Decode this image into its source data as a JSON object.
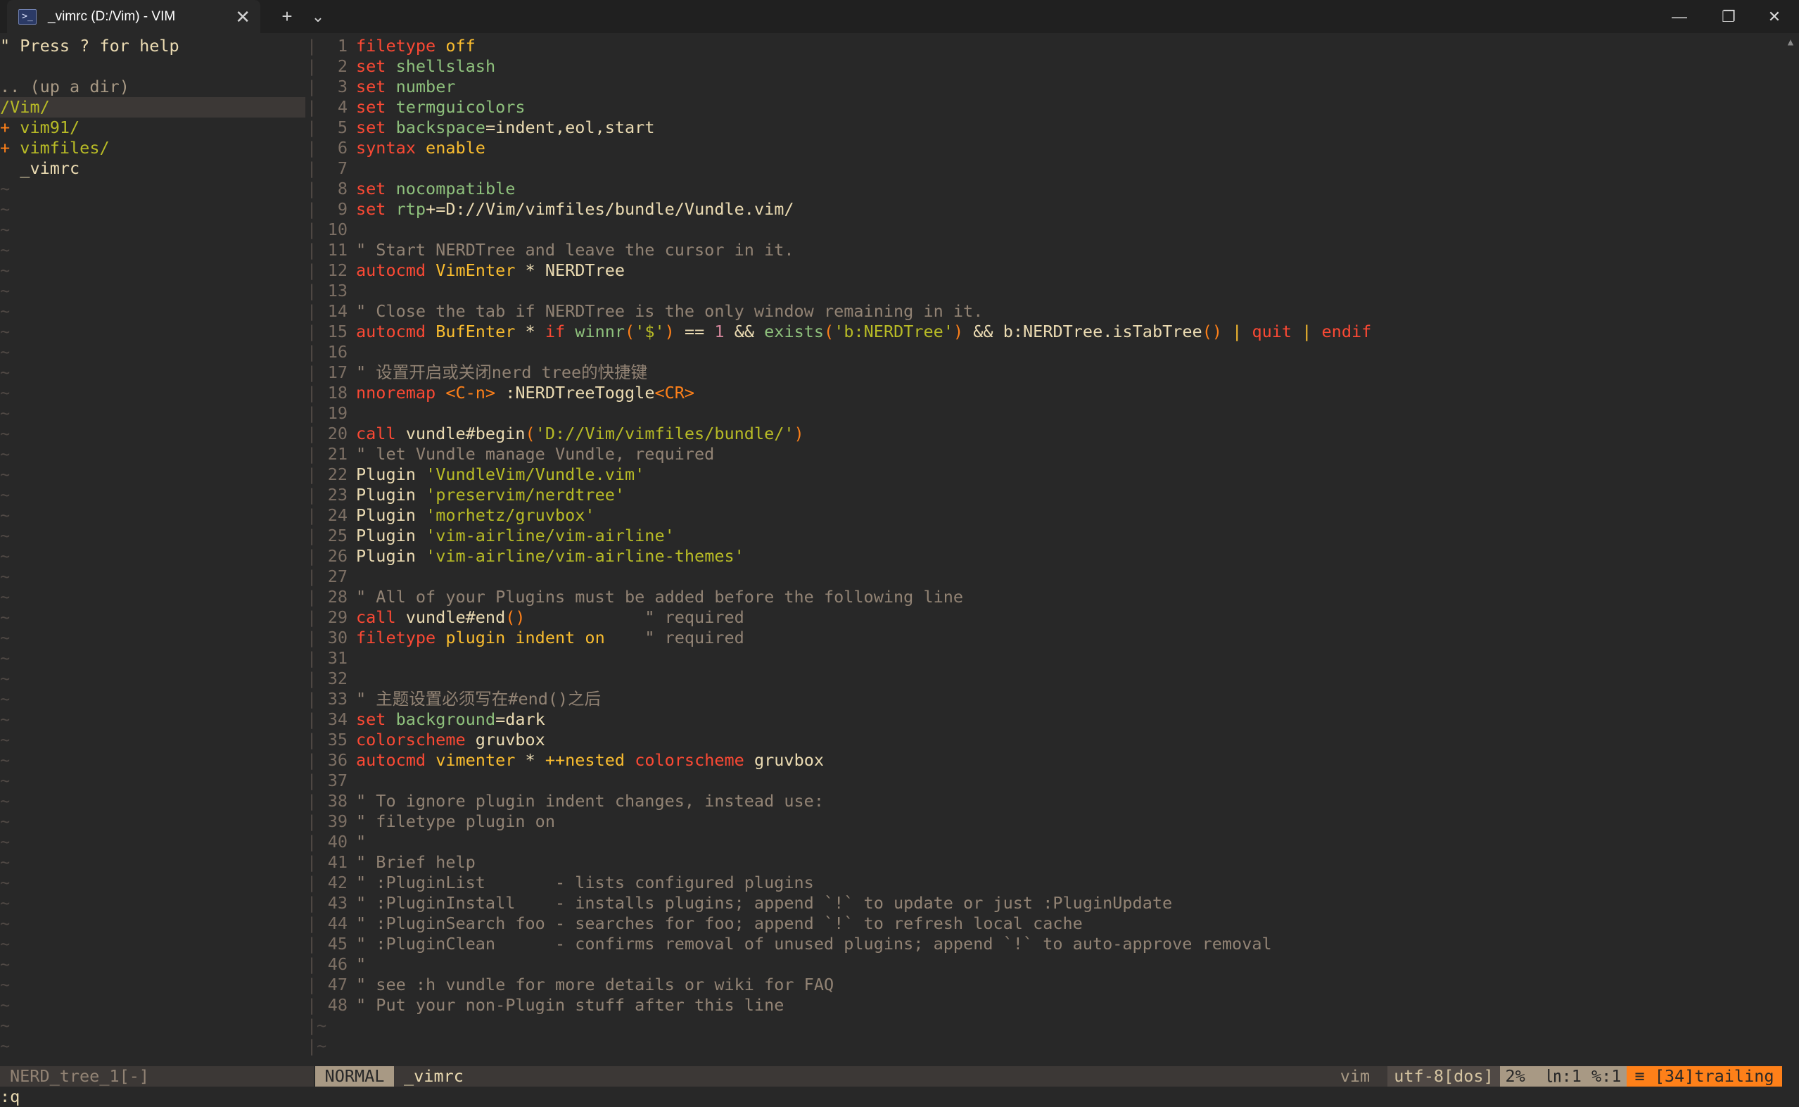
{
  "window": {
    "tab_title": "_vimrc (D:/Vim) - VIM",
    "tab_icon": "terminal-icon",
    "close_tab_glyph": "✕",
    "new_tab_glyph": "+",
    "dropdown_glyph": "⌄",
    "minimize_glyph": "—",
    "restore_glyph": "❐",
    "close_glyph": "✕"
  },
  "tree": {
    "help": "\" Press ? for help",
    "updir": ".. (up a dir)",
    "cwd": "/Vim/",
    "items": [
      {
        "prefix": "+ ",
        "name": "vim91/",
        "type": "dir"
      },
      {
        "prefix": "+ ",
        "name": "vimfiles/",
        "type": "dir"
      },
      {
        "prefix": "  ",
        "name": "_vimrc",
        "type": "file"
      }
    ],
    "filler": "~"
  },
  "code": [
    {
      "n": "1",
      "t": [
        [
          "kw",
          "filetype"
        ],
        [
          "pl",
          " "
        ],
        [
          "kv",
          "off"
        ]
      ]
    },
    {
      "n": "2",
      "t": [
        [
          "kw",
          "set"
        ],
        [
          "pl",
          " "
        ],
        [
          "opt",
          "shellslash"
        ]
      ]
    },
    {
      "n": "3",
      "t": [
        [
          "kw",
          "set"
        ],
        [
          "pl",
          " "
        ],
        [
          "opt",
          "number"
        ]
      ]
    },
    {
      "n": "4",
      "t": [
        [
          "kw",
          "set"
        ],
        [
          "pl",
          " "
        ],
        [
          "opt",
          "termguicolors"
        ]
      ]
    },
    {
      "n": "5",
      "t": [
        [
          "kw",
          "set"
        ],
        [
          "pl",
          " "
        ],
        [
          "opt",
          "backspace"
        ],
        [
          "pl",
          "=indent,eol,start"
        ]
      ]
    },
    {
      "n": "6",
      "t": [
        [
          "kw",
          "syntax"
        ],
        [
          "pl",
          " "
        ],
        [
          "kv",
          "enable"
        ]
      ]
    },
    {
      "n": "7",
      "t": []
    },
    {
      "n": "8",
      "t": [
        [
          "kw",
          "set"
        ],
        [
          "pl",
          " "
        ],
        [
          "opt",
          "nocompatible"
        ]
      ]
    },
    {
      "n": "9",
      "t": [
        [
          "kw",
          "set"
        ],
        [
          "pl",
          " "
        ],
        [
          "opt",
          "rtp"
        ],
        [
          "pl",
          "+=D://Vim/vimfiles/bundle/Vundle.vim/"
        ]
      ]
    },
    {
      "n": "10",
      "t": []
    },
    {
      "n": "11",
      "t": [
        [
          "cm",
          "\" Start NERDTree and leave the cursor in it."
        ]
      ]
    },
    {
      "n": "12",
      "t": [
        [
          "kw",
          "autocmd"
        ],
        [
          "pl",
          " "
        ],
        [
          "ev",
          "VimEnter"
        ],
        [
          "pl",
          " * NERDTree"
        ]
      ]
    },
    {
      "n": "13",
      "t": []
    },
    {
      "n": "14",
      "t": [
        [
          "cm",
          "\" Close the tab if NERDTree is the only window remaining in it."
        ]
      ]
    },
    {
      "n": "15",
      "t": [
        [
          "kw",
          "autocmd"
        ],
        [
          "pl",
          " "
        ],
        [
          "ev",
          "BufEnter"
        ],
        [
          "pl",
          " * "
        ],
        [
          "kw",
          "if"
        ],
        [
          "pl",
          " "
        ],
        [
          "fn",
          "winnr"
        ],
        [
          "sp",
          "("
        ],
        [
          "str",
          "'$'"
        ],
        [
          "sp",
          ")"
        ],
        [
          "pl",
          " == "
        ],
        [
          "num",
          "1"
        ],
        [
          "pl",
          " && "
        ],
        [
          "fn",
          "exists"
        ],
        [
          "sp",
          "("
        ],
        [
          "str",
          "'b:NERDTree'"
        ],
        [
          "sp",
          ")"
        ],
        [
          "pl",
          " && b:NERDTree.isTabTree"
        ],
        [
          "sp",
          "()"
        ],
        [
          "pl",
          " "
        ],
        [
          "kv",
          "|"
        ],
        [
          "pl",
          " "
        ],
        [
          "kw",
          "quit"
        ],
        [
          "pl",
          " "
        ],
        [
          "kv",
          "|"
        ],
        [
          "pl",
          " "
        ],
        [
          "kw",
          "endif"
        ]
      ]
    },
    {
      "n": "16",
      "t": []
    },
    {
      "n": "17",
      "t": [
        [
          "cm",
          "\" 设置开启或关闭nerd tree的快捷键"
        ]
      ]
    },
    {
      "n": "18",
      "t": [
        [
          "kw",
          "nnoremap"
        ],
        [
          "pl",
          " "
        ],
        [
          "sp",
          "<C-n>"
        ],
        [
          "pl",
          " :NERDTreeToggle"
        ],
        [
          "sp",
          "<CR>"
        ]
      ]
    },
    {
      "n": "19",
      "t": []
    },
    {
      "n": "20",
      "t": [
        [
          "kw",
          "call"
        ],
        [
          "pl",
          " vundle#begin"
        ],
        [
          "sp",
          "("
        ],
        [
          "str",
          "'D://Vim/vimfiles/bundle/'"
        ],
        [
          "sp",
          ")"
        ]
      ]
    },
    {
      "n": "21",
      "t": [
        [
          "cm",
          "\" let Vundle manage Vundle, required"
        ]
      ]
    },
    {
      "n": "22",
      "t": [
        [
          "pl",
          "Plugin "
        ],
        [
          "str",
          "'VundleVim/Vundle.vim'"
        ]
      ]
    },
    {
      "n": "23",
      "t": [
        [
          "pl",
          "Plugin "
        ],
        [
          "str",
          "'preservim/nerdtree'"
        ]
      ]
    },
    {
      "n": "24",
      "t": [
        [
          "pl",
          "Plugin "
        ],
        [
          "str",
          "'morhetz/gruvbox'"
        ]
      ]
    },
    {
      "n": "25",
      "t": [
        [
          "pl",
          "Plugin "
        ],
        [
          "str",
          "'vim-airline/vim-airline'"
        ]
      ]
    },
    {
      "n": "26",
      "t": [
        [
          "pl",
          "Plugin "
        ],
        [
          "str",
          "'vim-airline/vim-airline-themes'"
        ]
      ]
    },
    {
      "n": "27",
      "t": []
    },
    {
      "n": "28",
      "t": [
        [
          "cm",
          "\" All of your Plugins must be added before the following line"
        ]
      ]
    },
    {
      "n": "29",
      "t": [
        [
          "kw",
          "call"
        ],
        [
          "pl",
          " vundle#end"
        ],
        [
          "sp",
          "()"
        ],
        [
          "pl",
          "            "
        ],
        [
          "cm",
          "\" required"
        ]
      ]
    },
    {
      "n": "30",
      "t": [
        [
          "kw",
          "filetype"
        ],
        [
          "pl",
          " "
        ],
        [
          "kv",
          "plugin indent on"
        ],
        [
          "pl",
          "    "
        ],
        [
          "cm",
          "\" required"
        ]
      ]
    },
    {
      "n": "31",
      "t": []
    },
    {
      "n": "32",
      "t": []
    },
    {
      "n": "33",
      "t": [
        [
          "cm",
          "\" 主题设置必须写在#end()之后"
        ]
      ]
    },
    {
      "n": "34",
      "t": [
        [
          "kw",
          "set"
        ],
        [
          "pl",
          " "
        ],
        [
          "opt",
          "background"
        ],
        [
          "pl",
          "=dark"
        ]
      ]
    },
    {
      "n": "35",
      "t": [
        [
          "kw",
          "colorscheme"
        ],
        [
          "pl",
          " gruvbox"
        ]
      ]
    },
    {
      "n": "36",
      "t": [
        [
          "kw",
          "autocmd"
        ],
        [
          "pl",
          " "
        ],
        [
          "ev",
          "vimenter"
        ],
        [
          "pl",
          " * "
        ],
        [
          "kv",
          "++nested"
        ],
        [
          "pl",
          " "
        ],
        [
          "kw",
          "colorscheme"
        ],
        [
          "pl",
          " gruvbox"
        ]
      ]
    },
    {
      "n": "37",
      "t": []
    },
    {
      "n": "38",
      "t": [
        [
          "cm",
          "\" To ignore plugin indent changes, instead use:"
        ]
      ]
    },
    {
      "n": "39",
      "t": [
        [
          "cm",
          "\" filetype plugin on"
        ]
      ]
    },
    {
      "n": "40",
      "t": [
        [
          "cm",
          "\""
        ]
      ]
    },
    {
      "n": "41",
      "t": [
        [
          "cm",
          "\" Brief help"
        ]
      ]
    },
    {
      "n": "42",
      "t": [
        [
          "cm",
          "\" :PluginList       - lists configured plugins"
        ]
      ]
    },
    {
      "n": "43",
      "t": [
        [
          "cm",
          "\" :PluginInstall    - installs plugins; append `!` to update or just :PluginUpdate"
        ]
      ]
    },
    {
      "n": "44",
      "t": [
        [
          "cm",
          "\" :PluginSearch foo - searches for foo; append `!` to refresh local cache"
        ]
      ]
    },
    {
      "n": "45",
      "t": [
        [
          "cm",
          "\" :PluginClean      - confirms removal of unused plugins; append `!` to auto-approve removal"
        ]
      ]
    },
    {
      "n": "46",
      "t": [
        [
          "cm",
          "\""
        ]
      ]
    },
    {
      "n": "47",
      "t": [
        [
          "cm",
          "\" see :h vundle for more details or wiki for FAQ"
        ]
      ]
    },
    {
      "n": "48",
      "t": [
        [
          "cm",
          "\" Put your non-Plugin stuff after this line"
        ]
      ]
    }
  ],
  "status": {
    "tree_buffer": "NERD_tree_1[-]",
    "mode": "NORMAL",
    "file": "_vimrc",
    "filetype": "vim",
    "encoding": "utf-8[dos]",
    "position": "2%  ㏑:1 %:1",
    "warning": "≡ [34]trailing"
  },
  "cmdline": ":q",
  "colors": {
    "background": "#282828",
    "foreground": "#ebdbb2",
    "keyword": "#fb4934",
    "string": "#b8bb26",
    "comment": "#928374",
    "warning": "#fe8019"
  }
}
